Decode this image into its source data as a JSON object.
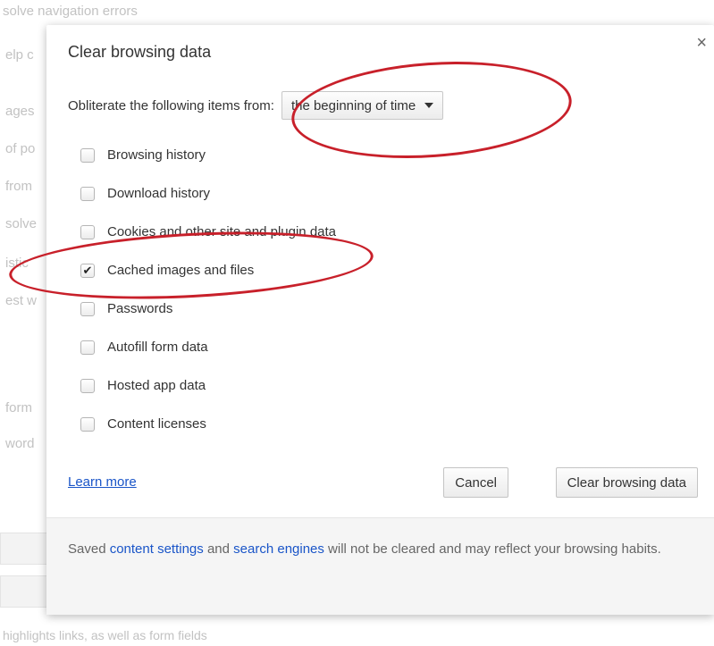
{
  "background": {
    "top_text": "solve navigation errors",
    "bottom_text": "highlights links, as well as form fields",
    "left_fragments": [
      "elp c",
      "ages",
      "of po",
      "from",
      "solve",
      "istic",
      "est w",
      "form",
      "word"
    ]
  },
  "dialog": {
    "title": "Clear browsing data",
    "close_symbol": "×",
    "range_label": "Obliterate the following items from:",
    "range_value": "the beginning of time",
    "options": [
      {
        "label": "Browsing history",
        "checked": false
      },
      {
        "label": "Download history",
        "checked": false
      },
      {
        "label": "Cookies and other site and plugin data",
        "checked": false
      },
      {
        "label": "Cached images and files",
        "checked": true
      },
      {
        "label": "Passwords",
        "checked": false
      },
      {
        "label": "Autofill form data",
        "checked": false
      },
      {
        "label": "Hosted app data",
        "checked": false
      },
      {
        "label": "Content licenses",
        "checked": false
      }
    ],
    "learn_more": "Learn more",
    "cancel_label": "Cancel",
    "clear_label": "Clear browsing data",
    "info": {
      "prefix": "Saved ",
      "link1": "content settings",
      "middle": " and ",
      "link2": "search engines",
      "suffix": " will not be cleared and may reflect your browsing habits."
    }
  },
  "colors": {
    "annotation": "#c8202a",
    "link": "#1a55c8"
  }
}
